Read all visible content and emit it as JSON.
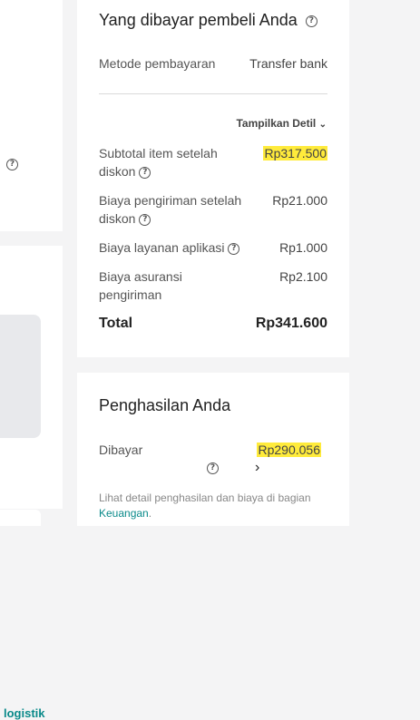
{
  "left": {
    "logistik_text": "logistik"
  },
  "buyer_paid": {
    "title": "Yang dibayar pembeli Anda",
    "payment_method_label": "Metode pembayaran",
    "payment_method_value": "Transfer bank",
    "show_details_label": "Tampilkan Detil",
    "rows": [
      {
        "label": "Subtotal item setelah",
        "label2": "diskon",
        "value": "Rp317.500",
        "highlight": true
      },
      {
        "label": "Biaya pengiriman setelah",
        "label2": "diskon",
        "value": "Rp21.000"
      },
      {
        "label": "Biaya layanan aplikasi",
        "value": "Rp1.000"
      },
      {
        "label": "Biaya asuransi",
        "label2": "pengiriman",
        "value": "Rp2.100"
      }
    ],
    "total_label": "Total",
    "total_value": "Rp341.600"
  },
  "earnings": {
    "title": "Penghasilan Anda",
    "paid_label": "Dibayar",
    "paid_value": "Rp290.056",
    "note_text": "Lihat detail penghasilan dan biaya di bagian",
    "note_link": "Keuangan",
    "note_end": "."
  },
  "colors": {
    "highlight": "#ffeb3b",
    "link": "#0a8a8a"
  }
}
